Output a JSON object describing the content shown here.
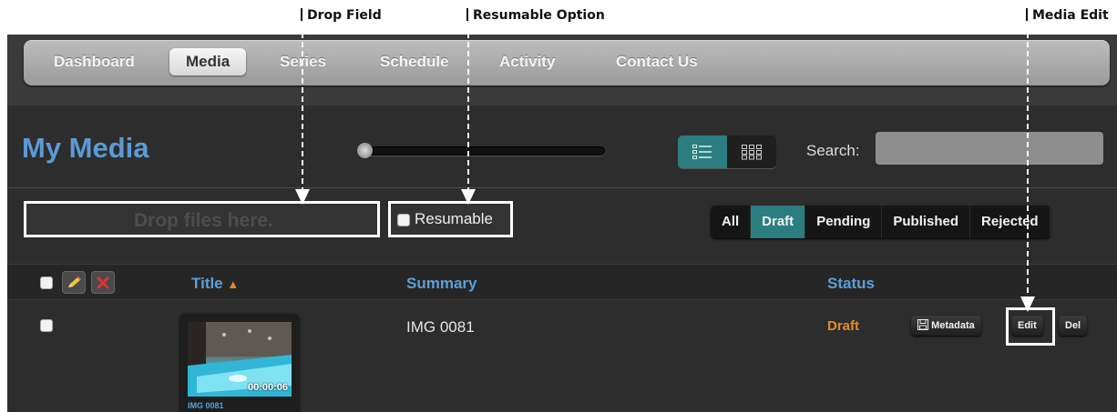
{
  "annotations": {
    "drop_field": "Drop Field",
    "resumable_option": "Resumable Option",
    "media_edit": "Media Edit"
  },
  "nav": {
    "items": [
      {
        "label": "Dashboard",
        "active": false
      },
      {
        "label": "Media",
        "active": true
      },
      {
        "label": "Series",
        "active": false
      },
      {
        "label": "Schedule",
        "active": false
      },
      {
        "label": "Activity",
        "active": false
      },
      {
        "label": "Contact Us",
        "active": false
      }
    ]
  },
  "header": {
    "title": "My Media",
    "search_label": "Search:",
    "search_value": "",
    "view_modes": [
      "list-view-icon",
      "grid-view-icon"
    ],
    "selected_view": "list"
  },
  "upload": {
    "drop_text": "Drop files here.",
    "resumable_label": "Resumable"
  },
  "filters": [
    {
      "label": "All",
      "active": false
    },
    {
      "label": "Draft",
      "active": true
    },
    {
      "label": "Pending",
      "active": false
    },
    {
      "label": "Published",
      "active": false
    },
    {
      "label": "Rejected",
      "active": false
    }
  ],
  "table": {
    "columns": {
      "title": "Title",
      "title_sort": "▲",
      "summary": "Summary",
      "status": "Status"
    },
    "header_icons": [
      "pencil-icon",
      "delete-x-icon"
    ],
    "rows": [
      {
        "summary": "IMG 0081",
        "status": "Draft",
        "thumb_duration": "00:00:06",
        "thumb_caption": "IMG 0081",
        "metadata_label": "Metadata",
        "edit_label": "Edit",
        "delete_label": "Del"
      }
    ]
  },
  "colors": {
    "accent_blue": "#5c9ad5",
    "active_teal": "#2c7d7f",
    "status_draft": "#e08c2a",
    "background": "#2d2d2d"
  }
}
